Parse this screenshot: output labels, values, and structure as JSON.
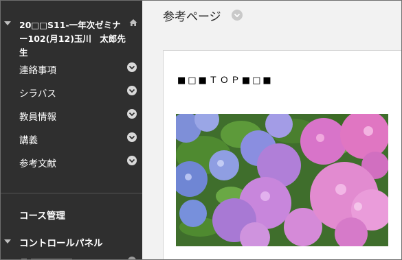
{
  "sidebar": {
    "course_title": "20□□S11-一年次ゼミナー102(月12)玉川　太郎先生",
    "items": [
      {
        "label": "連絡事項"
      },
      {
        "label": "シラバス"
      },
      {
        "label": "教員情報"
      },
      {
        "label": "講義"
      },
      {
        "label": "参考文献"
      }
    ],
    "course_management": "コース管理",
    "control_panel": "コントロールパネル"
  },
  "main": {
    "page_title": "参考ページ",
    "banner_text": "■□■ＴＯＰ■□■",
    "image_icon": "hydrangea-photo"
  },
  "colors": {
    "sidebar_bg": "#2f2f2f",
    "main_bg": "#f2f2f2"
  }
}
